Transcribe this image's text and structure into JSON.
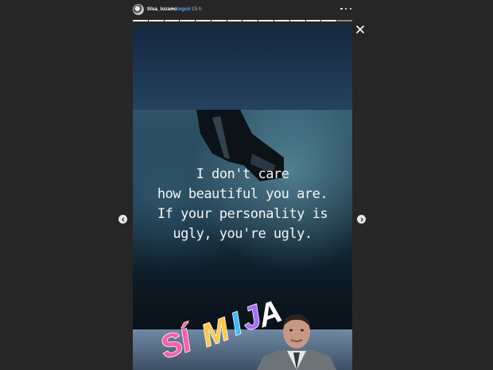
{
  "header": {
    "username": "tilsa_lozano",
    "separator": "•",
    "follow_label": "Seguir",
    "time": "15 h",
    "avatar_icon": "user-avatar",
    "more_icon": "more-horizontal-icon"
  },
  "progress": {
    "segments": 14,
    "current_index": 13
  },
  "story": {
    "quote_lines": [
      "I don't care",
      "how beautiful you are.",
      "If your personality is",
      "ugly, you're ugly."
    ],
    "sticker_text": "SÍ MIJA",
    "sticker_letters": [
      "S",
      "Í",
      "M",
      "I",
      "J",
      "A"
    ],
    "sticker_colors": [
      "#ff5ea8",
      "#ff5ea8",
      "#ffc94a",
      "#3fb8ff",
      "#a86bff",
      "#ffffff"
    ]
  },
  "controls": {
    "close_icon": "close-icon",
    "prev_icon": "chevron-left-icon",
    "next_icon": "chevron-right-icon"
  }
}
